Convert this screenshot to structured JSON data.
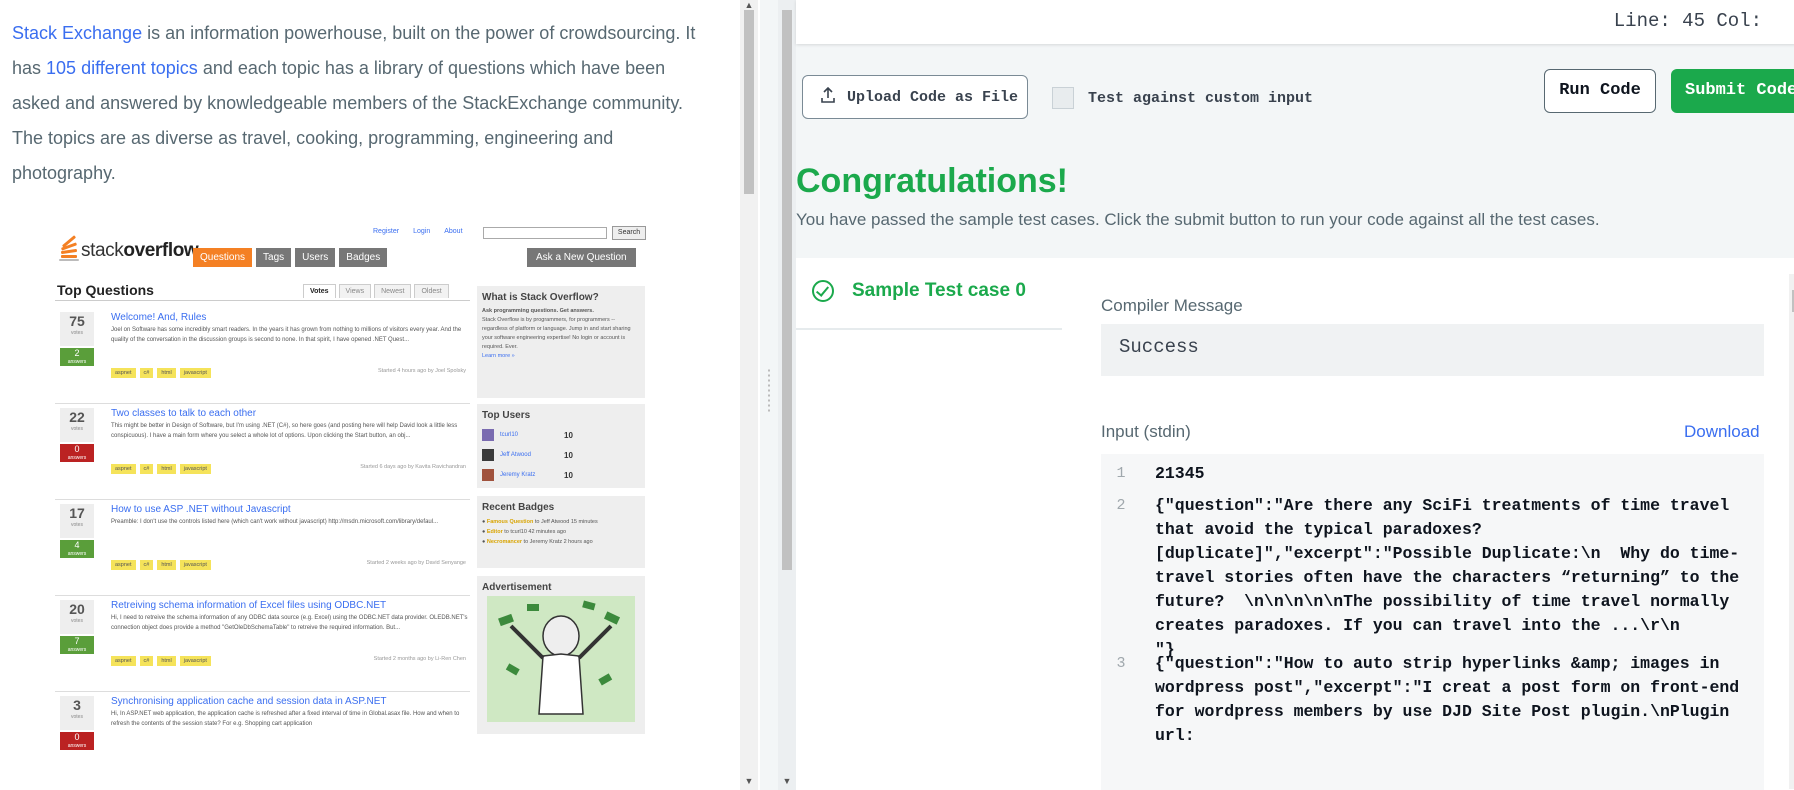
{
  "left": {
    "intro": {
      "link1": "Stack Exchange",
      "text1": " is an information powerhouse, built on the power of crowdsourcing. It has ",
      "link2": "105 different topics",
      "text2": " and each topic has a library of questions which have been asked and answered by knowledgeable members of the StackExchange community. The topics are as diverse as travel, cooking, programming, engineering and photography."
    },
    "so_image": {
      "logo_text_light": "stack",
      "logo_text_bold": "overflow",
      "top_links": [
        "Register",
        "Login",
        "About"
      ],
      "search_button": "Search",
      "nav": [
        "Questions",
        "Tags",
        "Users",
        "Badges"
      ],
      "ask_button": "Ask a New Question",
      "heading": "Top Questions",
      "tabs": [
        "Votes",
        "Views",
        "Newest",
        "Oldest"
      ],
      "questions": [
        {
          "votes": "75",
          "votes_label": "votes",
          "answers": "2",
          "answers_label": "answers",
          "title": "Welcome! And, Rules",
          "excerpt": "Joel on Software has some incredibly smart readers. In the years it has grown from nothing to millions of visitors every year. And the quality of the conversation in the discussion groups is second to none. In that spirit, I have opened .NET Quest...",
          "tags": [
            "aspnet",
            "c#",
            "html",
            "javascript"
          ],
          "asked": "Started 4 hours ago by  Joel Spolsky"
        },
        {
          "votes": "22",
          "votes_label": "votes",
          "answers": "0",
          "answers_label": "answers",
          "title": "Two classes to talk to each other",
          "excerpt": "This might be better in Design of Software, but I'm using .NET (C#), so here goes (and posting here will help David look a little less conspicuous). I have a main form where you select a whole lot of options. Upon clicking the Start button, an obj...",
          "tags": [
            "aspnet",
            "c#",
            "html",
            "javascript"
          ],
          "asked": "Started 6 days ago by  Kavita Ravichandran"
        },
        {
          "votes": "17",
          "votes_label": "votes",
          "answers": "4",
          "answers_label": "answers",
          "title": "How to use ASP .NET without Javascript",
          "excerpt": "Preamble: I don't use the controls listed here (which can't work without javascript) http://msdn.microsoft.com/library/defaul...",
          "tags": [
            "aspnet",
            "c#",
            "html",
            "javascript"
          ],
          "asked": "Started 2 weeks ago by  David Senyange"
        },
        {
          "votes": "20",
          "votes_label": "votes",
          "answers": "7",
          "answers_label": "answers",
          "title": "Retreiving schema information of Excel files using ODBC.NET",
          "excerpt": "Hi, I need to retreive the schema information of any ODBC data source (e.g. Excel) using the ODBC.NET data provider. OLEDB.NET's connection object does provide a method \"GetOleDbSchemaTable\" to retreive the required information. But...",
          "tags": [
            "aspnet",
            "c#",
            "html",
            "javascript"
          ],
          "asked": "Started 2 months ago by  Li-Ren Chen"
        },
        {
          "votes": "3",
          "votes_label": "votes",
          "answers": "0",
          "answers_label": "answers",
          "title": "Synchronising application cache and session data in ASP.NET",
          "excerpt": "Hi, In ASP.NET web application, the application cache is refreshed after a fixed interval of time in Global.asax file. How and when to refresh the contents of the session state? For e.g. Shopping cart application",
          "tags": [],
          "asked": ""
        }
      ],
      "side": {
        "what_title": "What is Stack Overflow?",
        "what_subtitle": "Ask programming questions. Get answers.",
        "what_body": "Stack Overflow is by programmers, for programmers -- regardless of platform or language. Jump in and start sharing your software engineering expertise! No login or account is required. Ever.",
        "learn_more": "Learn more »",
        "top_users_title": "Top Users",
        "top_users": [
          {
            "name": "tcurl10",
            "rep": "10"
          },
          {
            "name": "Jeff Atwood",
            "rep": "10"
          },
          {
            "name": "Jeremy Kratz",
            "rep": "10"
          }
        ],
        "badges_title": "Recent Badges",
        "badges": [
          {
            "badge": "Famous Question",
            "rest": " to Jeff Atwood 15 minutes"
          },
          {
            "badge": "Editor",
            "rest": " to tcurl10 42 minutes ago"
          },
          {
            "badge": "Necromancer",
            "rest": " to Jeremy Kratz 2 hours ago"
          }
        ],
        "ad_title": "Advertisement"
      }
    }
  },
  "editor": {
    "status": "Line: 45  Col:"
  },
  "toolbar": {
    "upload_label": "Upload Code as File",
    "custom_input_label": "Test against custom input",
    "run_label": "Run Code",
    "submit_label": "Submit Code"
  },
  "result": {
    "title": "Congratulations!",
    "subtitle": "You have passed the sample test cases. Click the submit button to run your code against all the test cases.",
    "testcase_label": "Sample Test case 0",
    "compiler_label": "Compiler Message",
    "compiler_value": "Success",
    "input_label": "Input (stdin)",
    "download_label": "Download",
    "input_lines": [
      {
        "n": "1",
        "text": "21345"
      },
      {
        "n": "2",
        "text": "{\"question\":\"Are there any SciFi treatments of time travel that avoid the typical paradoxes? [duplicate]\",\"excerpt\":\"Possible Duplicate:\\n  Why do time-travel stories often have the characters “returning” to the future?  \\n\\n\\n\\n\\nThe possibility of time travel normally creates paradoxes. If you can travel into the ...\\r\\n        \"}"
      },
      {
        "n": "3",
        "text": "{\"question\":\"How to auto strip hyperlinks &amp; images in wordpress post\",\"excerpt\":\"I creat a post form on front-end for wordpress members by use DJD Site Post plugin.\\nPlugin url:"
      }
    ]
  },
  "colors": {
    "accent_green": "#1ba94c",
    "link_blue": "#3a6ef0",
    "text_gray": "#576871",
    "so_orange": "#f48024"
  }
}
